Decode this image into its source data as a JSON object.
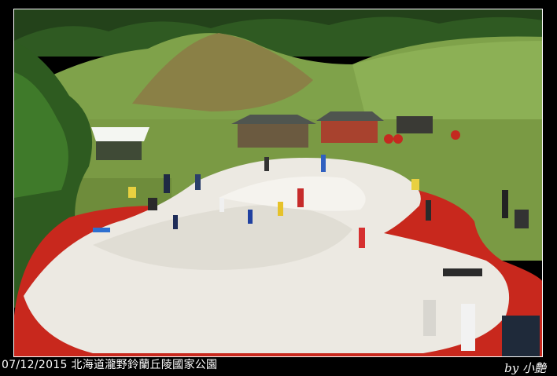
{
  "photo": {
    "caption": "07/12/2015 北海道瀧野鈴蘭丘陵國家公園",
    "signature": "by 小艶"
  },
  "colors": {
    "background": "#000000",
    "caption_text": "#ffffff",
    "dome": "#ece9e2",
    "track": "#c8281d",
    "grass": "#7fa24a",
    "trees": "#2f5a22"
  }
}
